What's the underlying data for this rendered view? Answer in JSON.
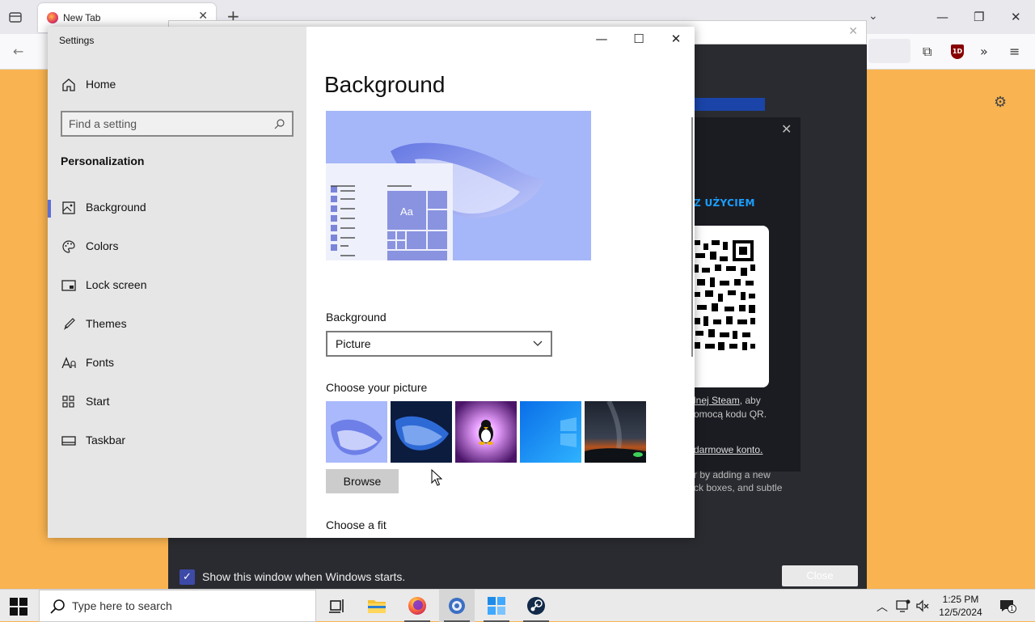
{
  "browser": {
    "tab_title": "New Tab",
    "tab_close": "✕",
    "new_tab": "+",
    "back": "←",
    "overflow": "»",
    "menu": "≡",
    "ublock_label": "1D"
  },
  "steam": {
    "qr_heading": "Z UŻYCIEM",
    "line1_link": "lnej Steam",
    "line1_rest": ", aby",
    "line2": "omocą kodu QR.",
    "line3_link": "darmowe konto.",
    "hint1": "r by adding a new",
    "hint2": "ck boxes, and subtle",
    "show_on_start": "Show this window when Windows starts.",
    "close_label": "Close"
  },
  "settings": {
    "window_title": "Settings",
    "home_label": "Home",
    "search_placeholder": "Find a setting",
    "section_label": "Personalization",
    "nav": [
      {
        "label": "Background",
        "icon": "picture-icon"
      },
      {
        "label": "Colors",
        "icon": "palette-icon"
      },
      {
        "label": "Lock screen",
        "icon": "lock-screen-icon"
      },
      {
        "label": "Themes",
        "icon": "brush-icon"
      },
      {
        "label": "Fonts",
        "icon": "font-icon"
      },
      {
        "label": "Start",
        "icon": "start-grid-icon"
      },
      {
        "label": "Taskbar",
        "icon": "taskbar-icon"
      }
    ],
    "page_title": "Background",
    "preview_sample_text": "Aa",
    "background_label": "Background",
    "background_value": "Picture",
    "choose_picture_label": "Choose your picture",
    "browse_label": "Browse",
    "choose_fit_label": "Choose a fit"
  },
  "taskbar": {
    "search_placeholder": "Type here to search",
    "time": "1:25 PM",
    "date": "12/5/2024",
    "notification_count": "1"
  },
  "colors": {
    "accent": "#5b6fd6",
    "steam_blue": "#1a9fff",
    "preview_bg": "#a5b7f9"
  }
}
